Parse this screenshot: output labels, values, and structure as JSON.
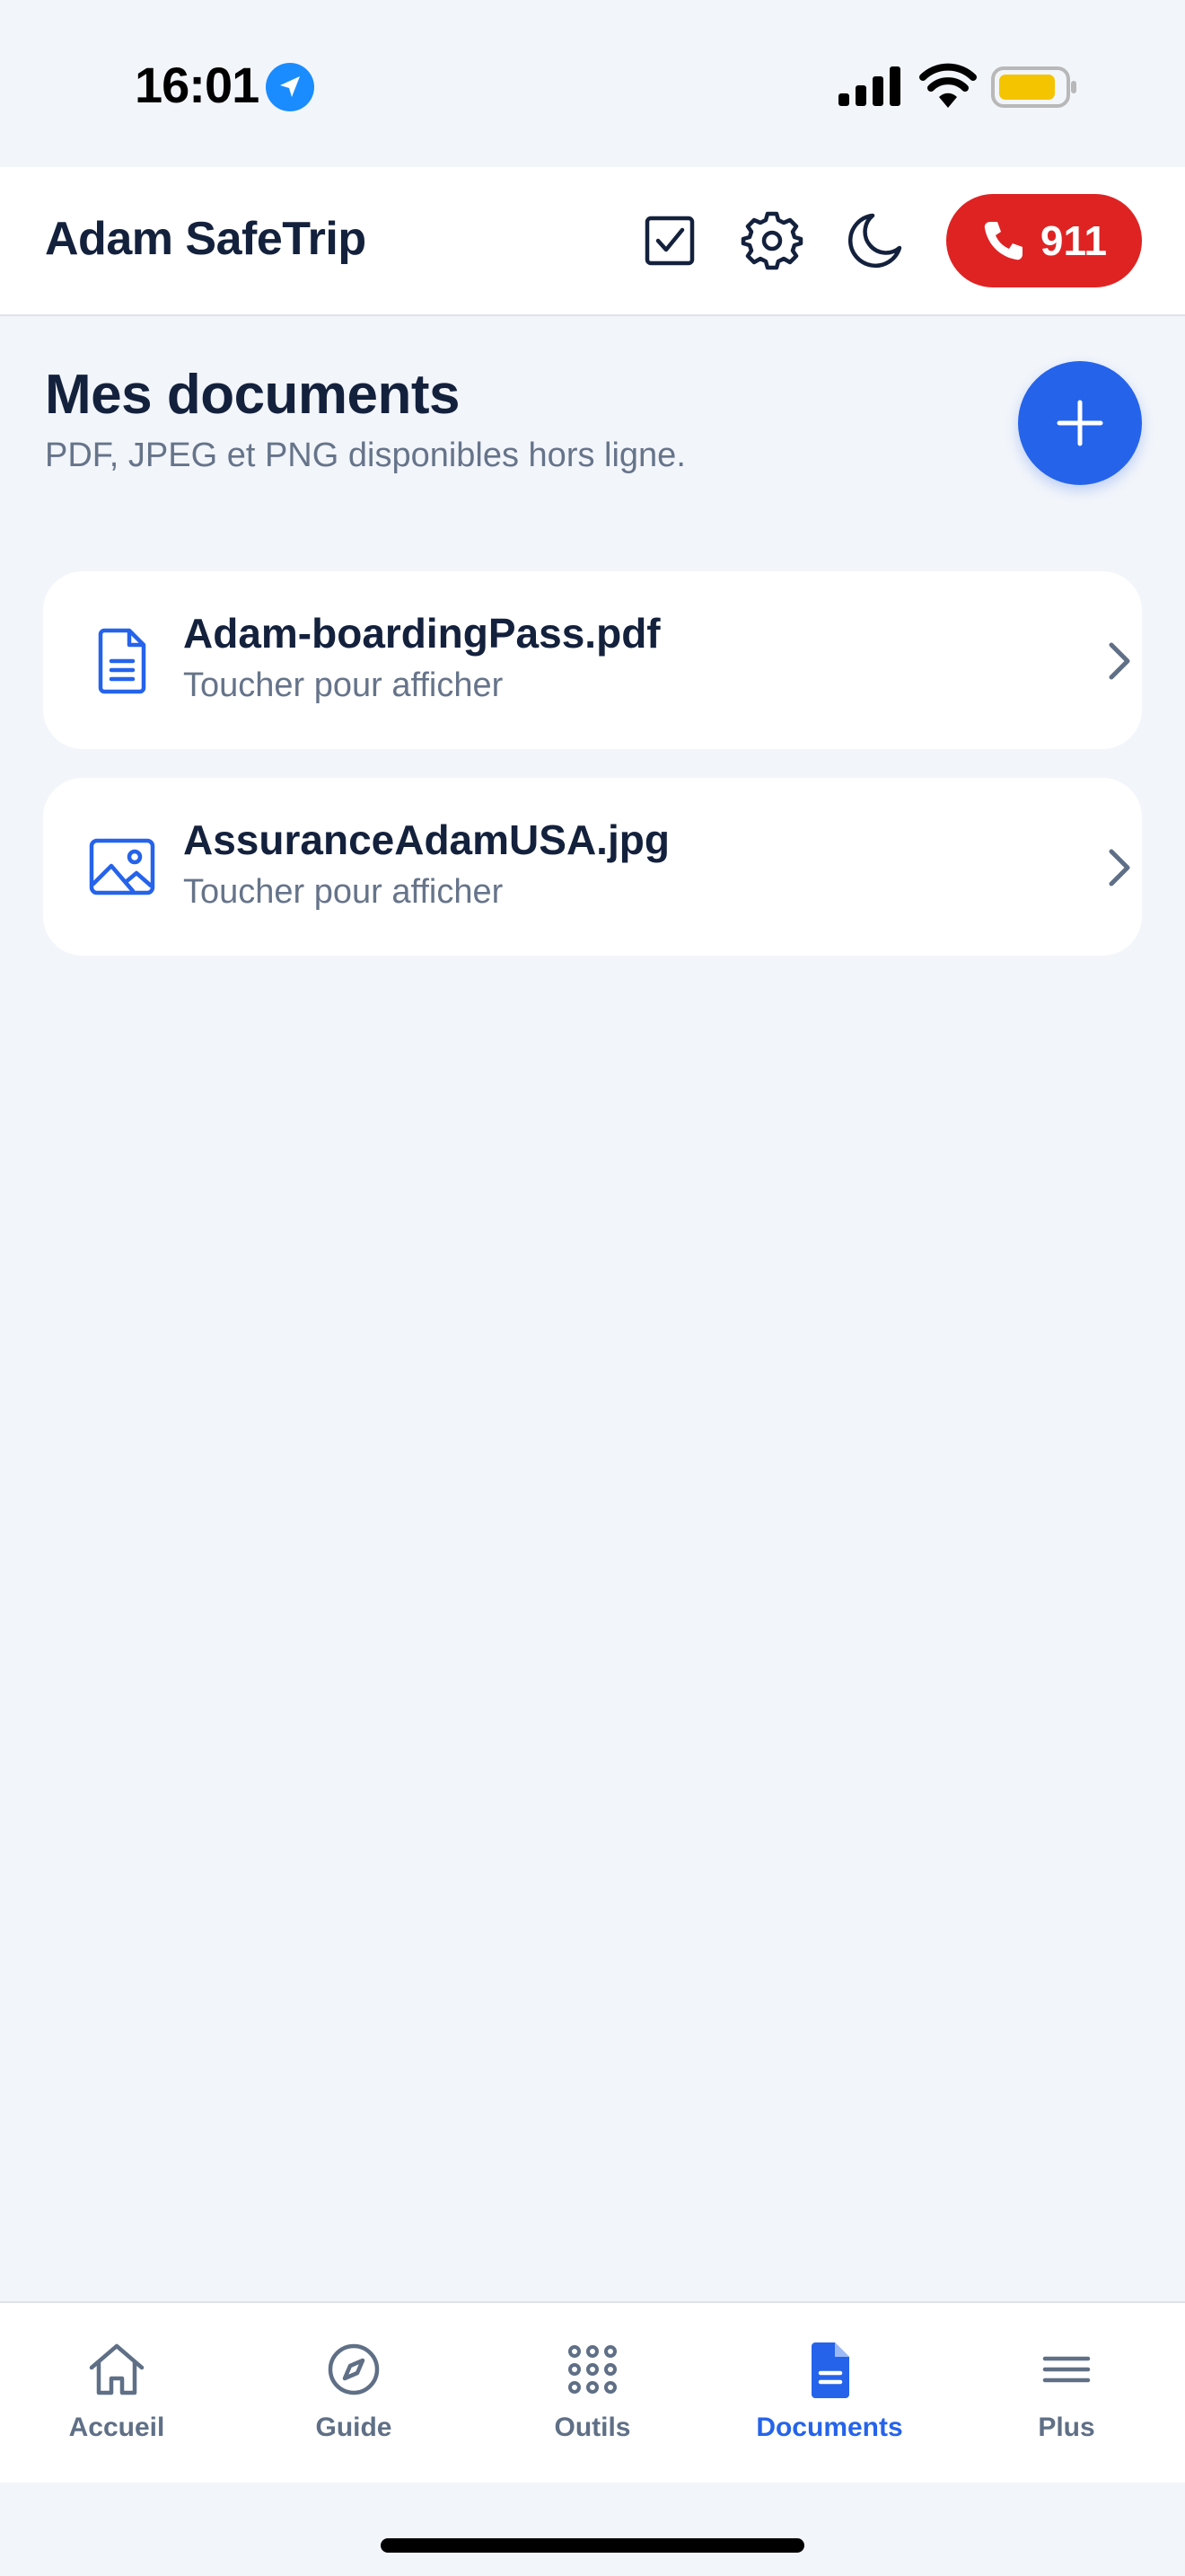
{
  "status_bar": {
    "time": "16:01"
  },
  "header": {
    "app_title": "Adam SafeTrip",
    "emergency_number": "911"
  },
  "page": {
    "title": "Mes documents",
    "subtitle": "PDF, JPEG et PNG disponibles hors ligne."
  },
  "documents": [
    {
      "name": "Adam-boardingPass.pdf",
      "hint": "Toucher pour afficher",
      "icon": "file-text-icon"
    },
    {
      "name": "AssuranceAdamUSA.jpg",
      "hint": "Toucher pour afficher",
      "icon": "image-icon"
    }
  ],
  "nav": {
    "items": [
      {
        "label": "Accueil",
        "icon": "home-icon",
        "active": false
      },
      {
        "label": "Guide",
        "icon": "compass-icon",
        "active": false
      },
      {
        "label": "Outils",
        "icon": "grid-dots-icon",
        "active": false
      },
      {
        "label": "Documents",
        "icon": "document-icon",
        "active": true
      },
      {
        "label": "Plus",
        "icon": "menu-icon",
        "active": false
      }
    ]
  },
  "colors": {
    "accent": "#2563eb",
    "emergency": "#df2323",
    "text_primary": "#14213d",
    "text_secondary": "#66748a",
    "background": "#f2f5fa"
  }
}
